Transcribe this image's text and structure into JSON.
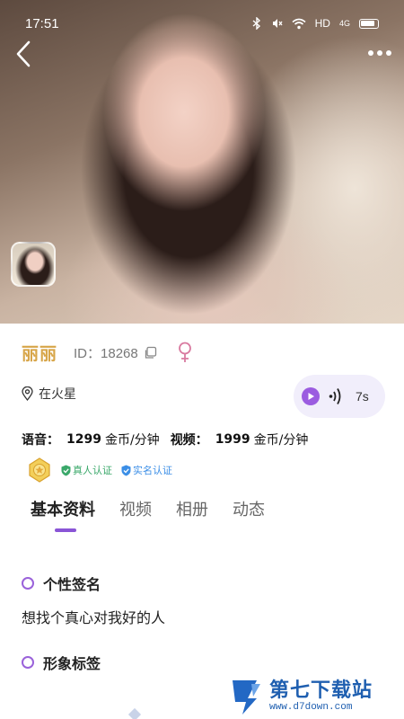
{
  "status_bar": {
    "time": "17:51",
    "network_label": "HD",
    "signal_label": "4G"
  },
  "hero": {
    "back_icon": "chevron-left-icon",
    "more_icon": "more-horizontal-icon"
  },
  "profile": {
    "nickname": "丽丽",
    "id_text": "ID：18268",
    "gender": "female",
    "location": "在火星",
    "voice_duration": "7s"
  },
  "pricing": {
    "voice_label": "语音：",
    "voice_price": "1299",
    "voice_unit": "金币/分钟",
    "video_label": "视频：",
    "video_price": "1999",
    "video_unit": "金币/分钟"
  },
  "badges": {
    "real_person": "真人认证",
    "real_name": "实名认证"
  },
  "tabs": [
    {
      "label": "基本资料",
      "active": true
    },
    {
      "label": "视频",
      "active": false
    },
    {
      "label": "相册",
      "active": false
    },
    {
      "label": "动态",
      "active": false
    }
  ],
  "sections": {
    "signature_title": "个性签名",
    "signature_text": "想找个真心对我好的人",
    "tags_title": "形象标签"
  },
  "watermark": {
    "name": "第七下载站",
    "url": "www.d7down.com"
  },
  "colors": {
    "accent": "#8a55d6",
    "nickname": "#d7a548",
    "gender": "#d97aa0",
    "cert_green": "#3aa86a",
    "cert_blue": "#3b8ee6"
  }
}
